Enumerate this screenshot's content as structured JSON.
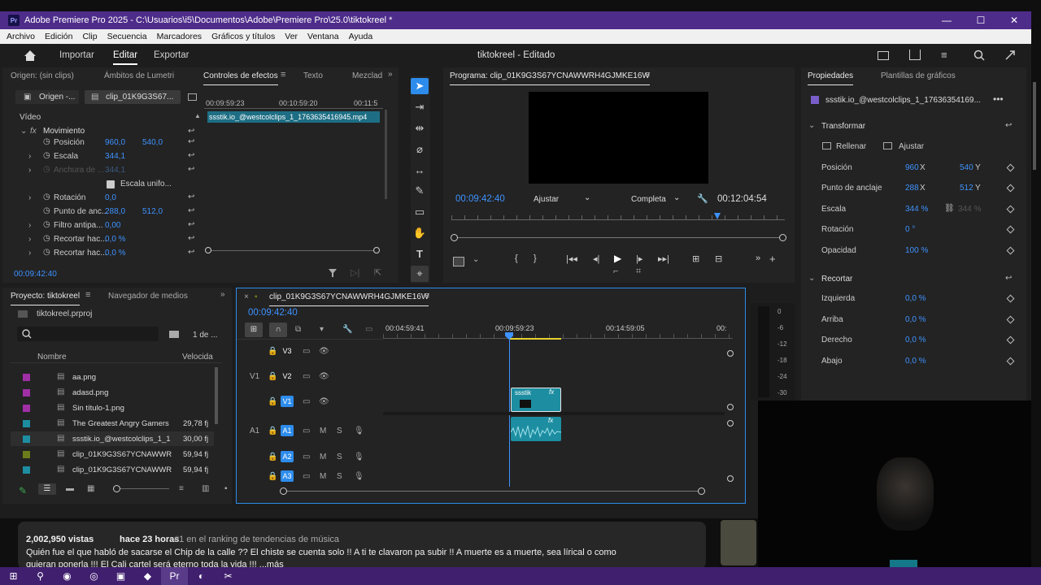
{
  "window": {
    "title": "Adobe Premiere Pro 2025 - C:\\Usuarios\\i5\\Documentos\\Adobe\\Premiere Pro\\25.0\\tiktokreel *",
    "app_icon": "Pr"
  },
  "menu": [
    "Archivo",
    "Edición",
    "Clip",
    "Secuencia",
    "Marcadores",
    "Gráficos y títulos",
    "Ver",
    "Ventana",
    "Ayuda"
  ],
  "header": {
    "tabs": [
      "Importar",
      "Editar",
      "Exportar"
    ],
    "active_tab": "Editar",
    "project_title": "tiktokreel - Editado"
  },
  "effect_controls": {
    "tabs": [
      "Origen: (sin clips)",
      "Ámbitos de Lumetri",
      "Controles de efectos",
      "Texto",
      "Mezclad"
    ],
    "source_dropdown": "Origen -...",
    "clip_dropdown": "clip_01K9G3S67...",
    "ruler": [
      "00:09:59:23",
      "00:10:59:20",
      "00:11:5"
    ],
    "clip_bar": "ssstik.io_@westcolclips_1_1763635416945.mp4",
    "section": "Vídeo",
    "effect": "Movimiento",
    "rows": [
      {
        "label": "Posición",
        "v1": "960,0",
        "v2": "540,0"
      },
      {
        "label": "Escala",
        "v1": "344,1"
      },
      {
        "label": "Anchura de ...",
        "v1": "344,1"
      },
      {
        "label": "Escala unifo..."
      },
      {
        "label": "Rotación",
        "v1": "0,0"
      },
      {
        "label": "Punto de anc...",
        "v1": "288,0",
        "v2": "512,0"
      },
      {
        "label": "Filtro antipa...",
        "v1": "0,00"
      },
      {
        "label": "Recortar hac...",
        "v1": "0,0 %"
      },
      {
        "label": "Recortar hac...",
        "v1": "0,0 %"
      }
    ],
    "timecode": "00:09:42:40"
  },
  "program": {
    "title": "Programa: clip_01K9G3S67YCNAWWRH4GJMKE16W",
    "timecode": "00:09:42:40",
    "fit": "Ajustar",
    "quality": "Completa",
    "duration": "00:12:04:54"
  },
  "properties": {
    "tabs": [
      "Propiedades",
      "Plantillas de gráficos"
    ],
    "clip_name": "ssstik.io_@westcolclips_1_17636354169...",
    "transform_label": "Transformar",
    "fill_label": "Rellenar",
    "fit_label": "Ajustar",
    "rows": [
      {
        "label": "Posición",
        "v1": "960",
        "u1": "X",
        "v2": "540",
        "u2": "Y"
      },
      {
        "label": "Punto de anclaje",
        "v1": "288",
        "u1": "X",
        "v2": "512",
        "u2": "Y"
      },
      {
        "label": "Escala",
        "v1": "344 %",
        "v2": "344 %"
      },
      {
        "label": "Rotación",
        "v1": "0 °"
      },
      {
        "label": "Opacidad",
        "v1": "100 %"
      }
    ],
    "crop_label": "Recortar",
    "crop_rows": [
      {
        "label": "Izquierda",
        "v": "0,0 %"
      },
      {
        "label": "Arriba",
        "v": "0,0 %"
      },
      {
        "label": "Derecho",
        "v": "0,0 %"
      },
      {
        "label": "Abajo",
        "v": "0,0 %"
      }
    ]
  },
  "project": {
    "tabs": [
      "Proyecto: tiktokreel",
      "Navegador de medios"
    ],
    "file": "tiktokreel.prproj",
    "count": "1 de ...",
    "col_name": "Nombre",
    "col_speed": "Velocida",
    "items": [
      {
        "name": "aa.png",
        "speed": "",
        "color": "#a02fa6"
      },
      {
        "name": "adasd.png",
        "speed": "",
        "color": "#a02fa6"
      },
      {
        "name": "Sin título-1.png",
        "speed": "",
        "color": "#a02fa6"
      },
      {
        "name": "The Greatest Angry Gamers",
        "speed": "29,78 fj",
        "color": "#1d8ea1"
      },
      {
        "name": "ssstik.io_@westcolclips_1_1",
        "speed": "30,00 fj",
        "color": "#1d8ea1"
      },
      {
        "name": "clip_01K9G3S67YCNAWWR",
        "speed": "59,94 fj",
        "color": "#6b7d1a"
      },
      {
        "name": "clip_01K9G3S67YCNAWWR",
        "speed": "59,94 fj",
        "color": "#1d8ea1"
      }
    ]
  },
  "timeline": {
    "tab": "clip_01K9G3S67YCNAWWRH4GJMKE16W",
    "timecode": "00:09:42:40",
    "ruler": [
      "00:04:59:41",
      "00:09:59:23",
      "00:14:59:05",
      "00:"
    ],
    "video_tracks": [
      "V3",
      "V2",
      "V1"
    ],
    "audio_tracks": [
      "A1",
      "A2",
      "A3"
    ],
    "source_v": "V1",
    "source_a": "A1",
    "clip_label": "ssstik",
    "meter_scale": [
      "0",
      "-6",
      "-12",
      "-18",
      "-24",
      "-30"
    ]
  },
  "browser": {
    "views": "2,002,950 vistas",
    "ago": "hace 23 horas",
    "rank": "#1 en el ranking de tendencias de música",
    "desc1": "Quién fue el que habló de sacarse el Chip de la calle ?? El chiste se cuenta solo !! A ti te clavaron pa subir !! A muerte es a muerte, sea lírical o como",
    "desc2": "quieran ponerla !!! El Cali cartel será eterno toda la vida !!! ...más"
  },
  "colors": {
    "accent": "#2d8ceb",
    "titlebar": "#4e2c8a",
    "taskbar": "#401f6f",
    "panel": "#232323",
    "clip_video": "#1d8ea1",
    "playhead": "#3e92ff"
  }
}
